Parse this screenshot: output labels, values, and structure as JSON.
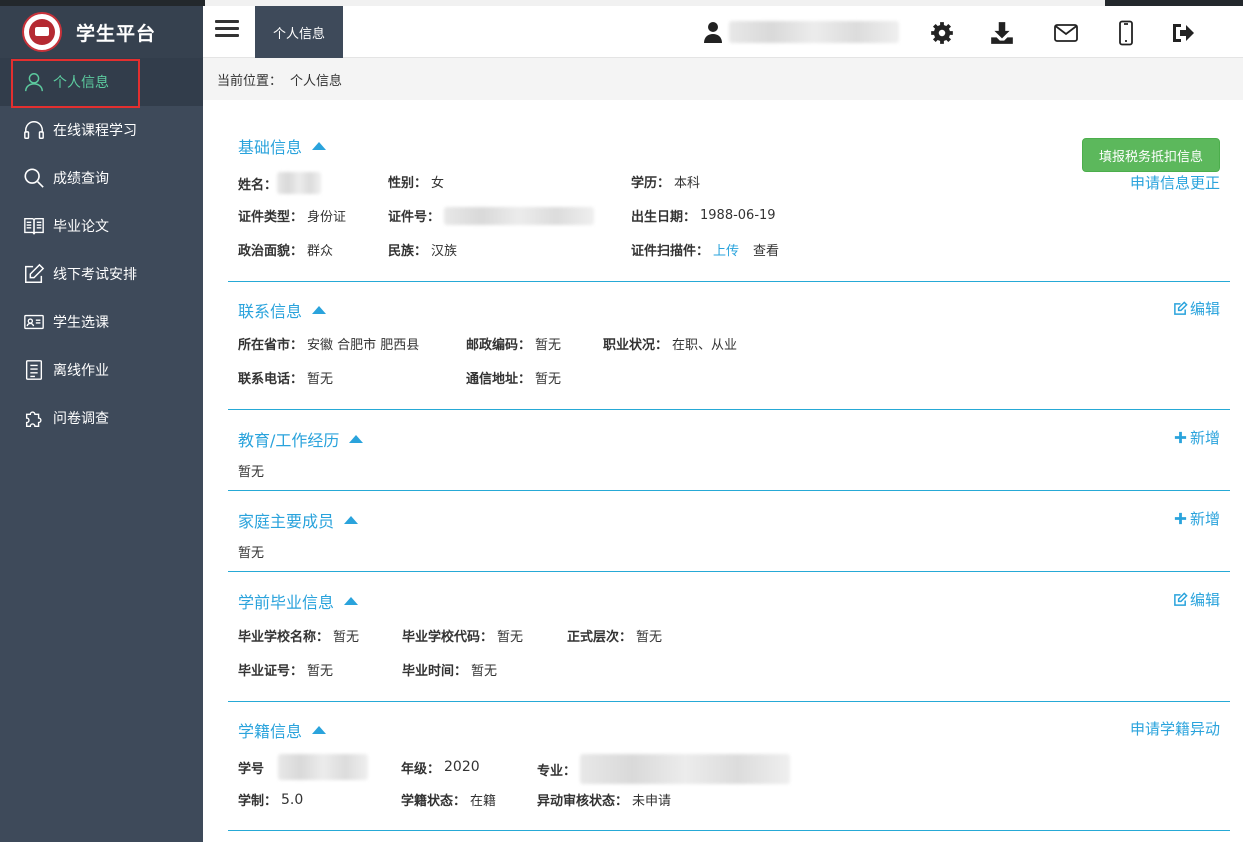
{
  "brand": {
    "title": "学生平台"
  },
  "sidebar": {
    "items": [
      {
        "label": "个人信息",
        "icon": "user-icon"
      },
      {
        "label": "在线课程学习",
        "icon": "headphones-icon"
      },
      {
        "label": "成绩查询",
        "icon": "search-icon"
      },
      {
        "label": "毕业论文",
        "icon": "book-icon"
      },
      {
        "label": "线下考试安排",
        "icon": "edit-icon"
      },
      {
        "label": "学生选课",
        "icon": "id-card-icon"
      },
      {
        "label": "离线作业",
        "icon": "document-icon"
      },
      {
        "label": "问卷调查",
        "icon": "puzzle-icon"
      }
    ]
  },
  "header": {
    "tab": "个人信息",
    "icons": [
      "gear-icon",
      "download-icon",
      "mail-icon",
      "mobile-icon",
      "logout-icon"
    ]
  },
  "breadcrumb": {
    "label": "当前位置：",
    "current": "个人信息"
  },
  "basic": {
    "title": "基础信息",
    "tax_button": "填报税务抵扣信息",
    "correction_link": "申请信息更正",
    "name_label": "姓名：",
    "gender_label": "性别：",
    "gender": "女",
    "education_label": "学历：",
    "education": "本科",
    "id_type_label": "证件类型：",
    "id_type": "身份证",
    "id_no_label": "证件号：",
    "birth_label": "出生日期：",
    "birth": "1988-06-19",
    "politics_label": "政治面貌：",
    "politics": "群众",
    "ethnic_label": "民族：",
    "ethnic": "汉族",
    "scan_label": "证件扫描件：",
    "upload": "上传",
    "view": "查看"
  },
  "contact": {
    "title": "联系信息",
    "edit": "编辑",
    "region_label": "所在省市：",
    "region": "安徽 合肥市 肥西县",
    "postcode_label": "邮政编码：",
    "postcode": "暂无",
    "job_label": "职业状况：",
    "job": "在职、从业",
    "phone_label": "联系电话：",
    "phone": "暂无",
    "address_label": "通信地址：",
    "address": "暂无"
  },
  "experience": {
    "title": "教育/工作经历",
    "add": "新增",
    "empty": "暂无"
  },
  "family": {
    "title": "家庭主要成员",
    "add": "新增",
    "empty": "暂无"
  },
  "prior": {
    "title": "学前毕业信息",
    "edit": "编辑",
    "school_label": "毕业学校名称：",
    "school": "暂无",
    "code_label": "毕业学校代码：",
    "code": "暂无",
    "level_label": "正式层次：",
    "level": "暂无",
    "cert_label": "毕业证号：",
    "cert": "暂无",
    "time_label": "毕业时间：",
    "time": "暂无"
  },
  "status": {
    "title": "学籍信息",
    "change_link": "申请学籍异动",
    "no_label": "学号",
    "grade_label": "年级：",
    "grade": "2020",
    "major_label": "专业：",
    "duration_label": "学制：",
    "duration": "5.0",
    "state_label": "学籍状态：",
    "state": "在籍",
    "review_label": "异动审核状态：",
    "review": "未申请"
  },
  "colors": {
    "accent": "#2aa3dc",
    "sidebar": "#3e4a5a",
    "active_text": "#5ccb9f",
    "green_button": "#5cb85c",
    "highlight_box": "#e32f2f"
  }
}
